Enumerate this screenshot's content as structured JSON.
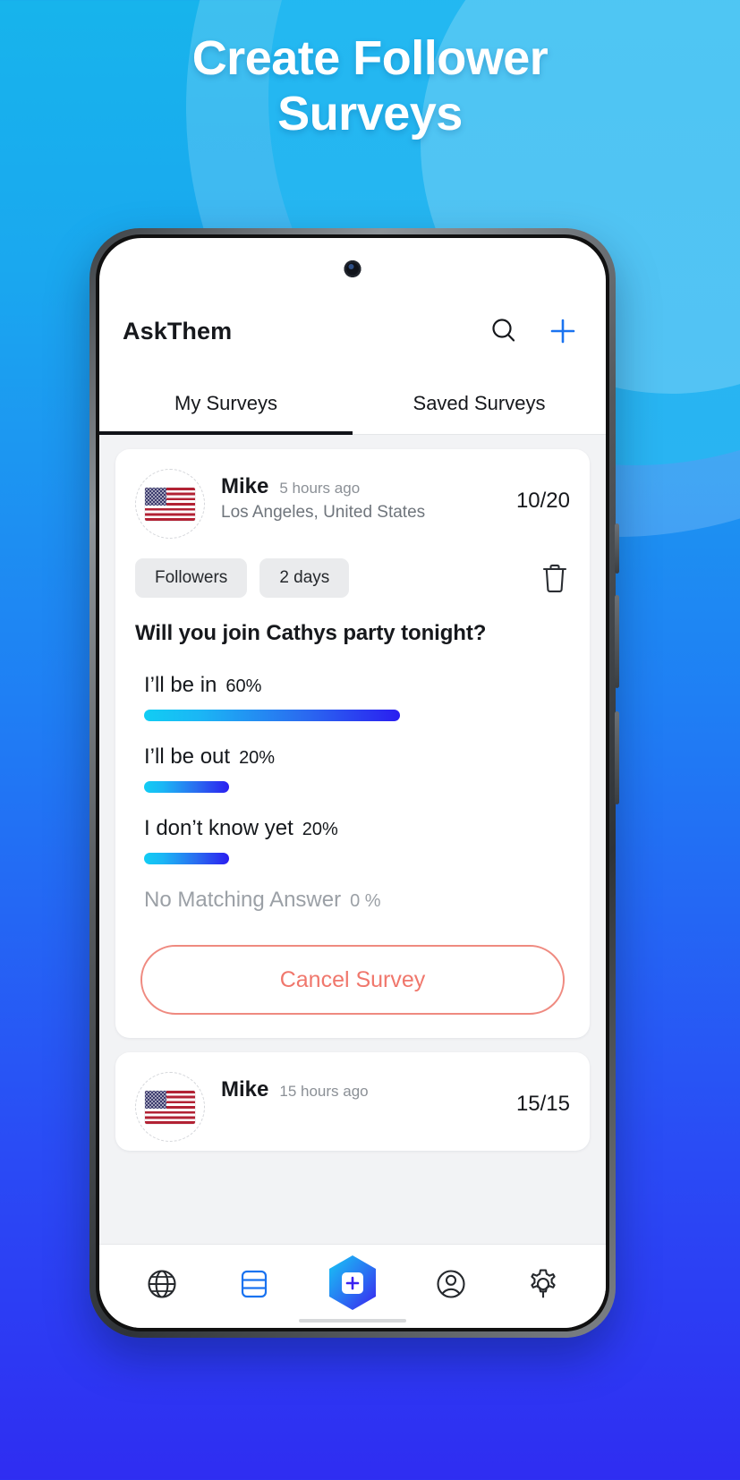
{
  "promo": {
    "headline_line1": "Create Follower",
    "headline_line2": "Surveys"
  },
  "app": {
    "title": "AskThem",
    "search_icon": "search-icon",
    "add_icon": "plus-icon"
  },
  "tabs": [
    {
      "label": "My Surveys",
      "active": true
    },
    {
      "label": "Saved Surveys",
      "active": false
    }
  ],
  "surveys": [
    {
      "author": "Mike",
      "time": "5 hours ago",
      "location": "Los Angeles, United States",
      "responses": "10/20",
      "flag": "us-flag-icon",
      "tags": [
        "Followers",
        "2 days"
      ],
      "delete_icon": "trash-icon",
      "question": "Will you join Cathys party tonight?",
      "options": [
        {
          "text": "I’ll be in",
          "percent_label": "60%",
          "percent": 60,
          "dim": false
        },
        {
          "text": "I’ll be out",
          "percent_label": "20%",
          "percent": 20,
          "dim": false
        },
        {
          "text": "I don’t know yet",
          "percent_label": "20%",
          "percent": 20,
          "dim": false
        },
        {
          "text": "No Matching Answer",
          "percent_label": "0 %",
          "percent": 0,
          "dim": true
        }
      ],
      "cancel_label": "Cancel Survey"
    },
    {
      "author": "Mike",
      "time": "15 hours ago",
      "responses": "15/15",
      "flag": "us-flag-icon"
    }
  ],
  "bottom_nav": [
    {
      "name": "globe-icon",
      "active": false
    },
    {
      "name": "database-icon",
      "active": true
    },
    {
      "name": "add-survey-icon",
      "active": true
    },
    {
      "name": "profile-icon",
      "active": false
    },
    {
      "name": "settings-gear-icon",
      "active": false
    }
  ],
  "colors": {
    "accent_blue": "#1a73f0",
    "bar_gradient_start": "#11cdf4",
    "bar_gradient_end": "#2a1ef0",
    "cancel_red": "#f0776c",
    "bg_top": "#17b4ec",
    "bg_bottom": "#2f2df2"
  }
}
